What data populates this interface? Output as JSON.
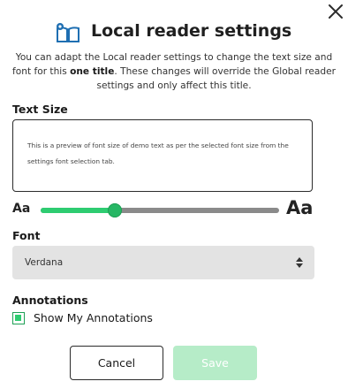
{
  "dialog": {
    "title": "Local reader settings",
    "description_before": "You can adapt the Local reader settings to change the text size and font for this ",
    "description_bold": "one title",
    "description_after": ". These changes will override the Global reader settings and only affect this title.",
    "close_icon": "close-icon",
    "title_icon": "book-settings-icon"
  },
  "text_size": {
    "label": "Text Size",
    "preview_text": "This is a preview of font size of demo text as per the selected font size from the settings font selection tab.",
    "small_label": "Aa",
    "large_label": "Aa",
    "slider_fraction": 0.31,
    "accent_color": "#2ecc71"
  },
  "font": {
    "label": "Font",
    "selected": "Verdana"
  },
  "annotations": {
    "label": "Annotations",
    "checkbox_label": "Show My Annotations",
    "checked": true
  },
  "actions": {
    "cancel_label": "Cancel",
    "save_label": "Save",
    "save_disabled": true
  }
}
